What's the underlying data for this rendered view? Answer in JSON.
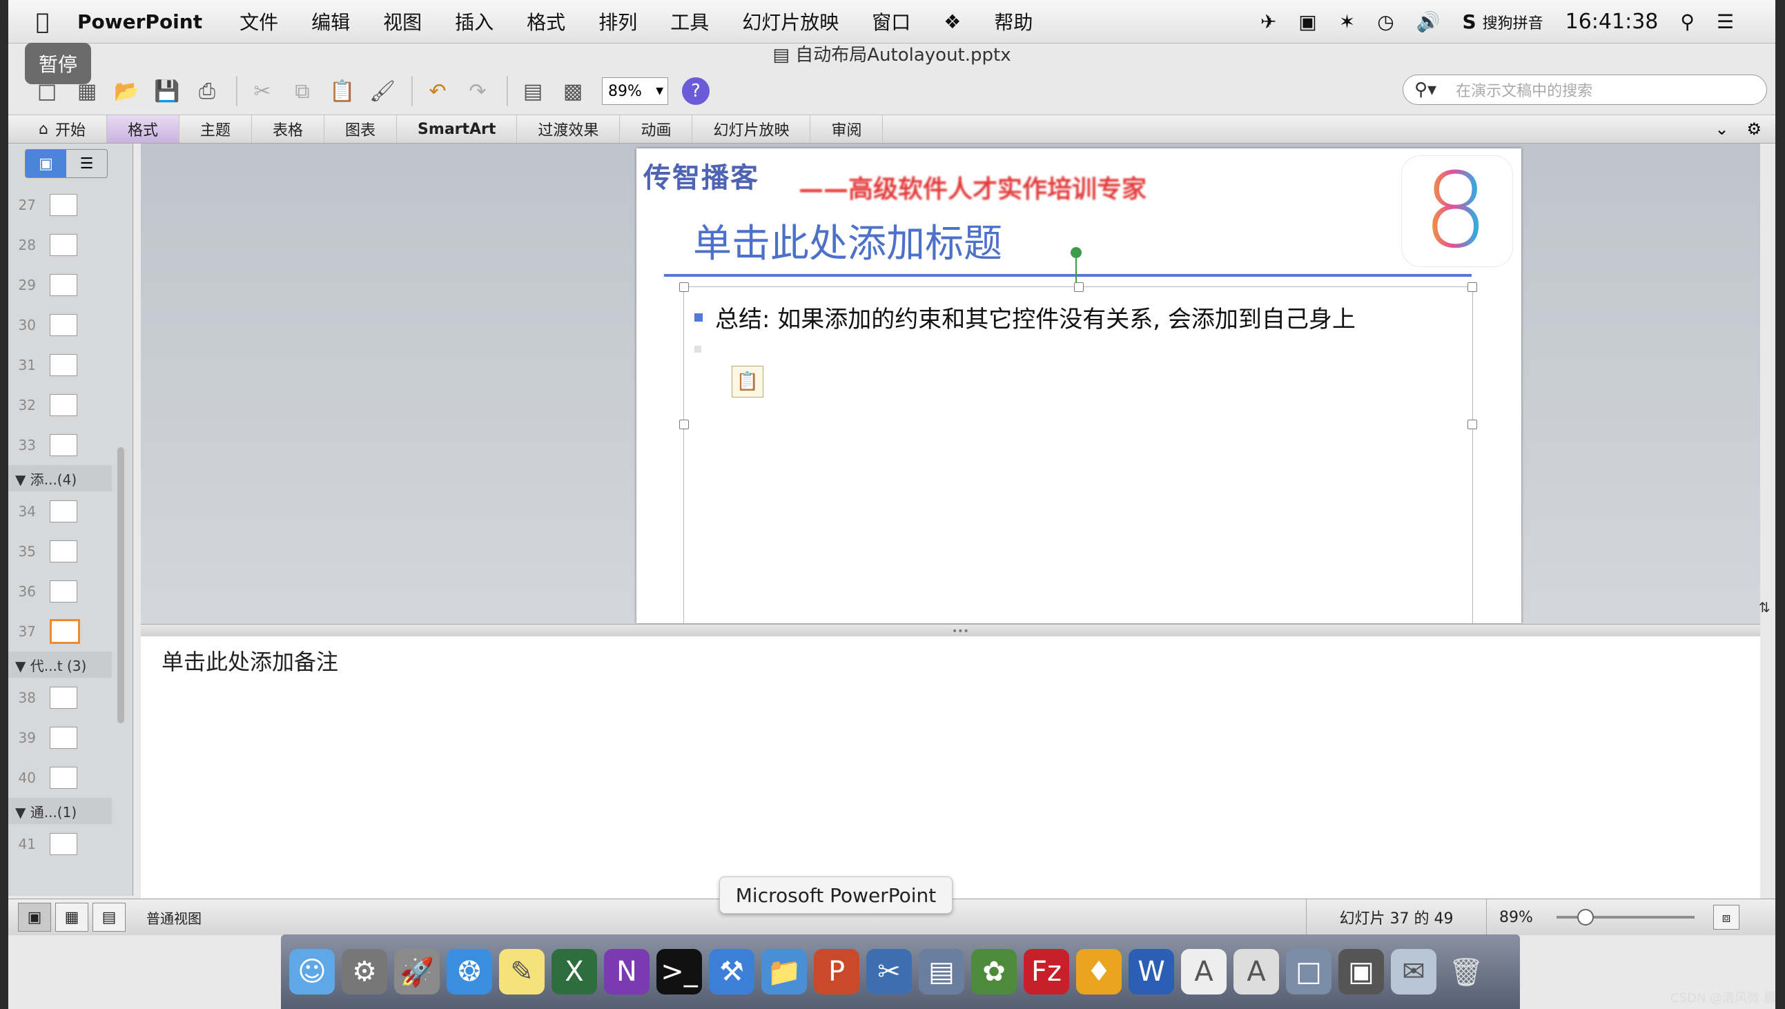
{
  "menubar": {
    "apple": "",
    "app": "PowerPoint",
    "items": [
      "文件",
      "编辑",
      "视图",
      "插入",
      "格式",
      "排列",
      "工具",
      "幻灯片放映",
      "窗口",
      "帮助"
    ],
    "ime": "搜狗拼音",
    "clock": "16:41:38"
  },
  "pause_badge": "暂停",
  "document_title": "自动布局Autolayout.pptx",
  "toolbar": {
    "zoom": "89%",
    "search_placeholder": "在演示文稿中的搜索"
  },
  "ribbon": {
    "tabs": [
      "开始",
      "格式",
      "主题",
      "表格",
      "图表",
      "SmartArt",
      "过渡效果",
      "动画",
      "幻灯片放映",
      "审阅"
    ],
    "active_index": 1
  },
  "slide_panel": {
    "rows": [
      {
        "type": "thumb",
        "num": "27"
      },
      {
        "type": "thumb",
        "num": "28"
      },
      {
        "type": "thumb",
        "num": "29"
      },
      {
        "type": "thumb",
        "num": "30"
      },
      {
        "type": "thumb",
        "num": "31"
      },
      {
        "type": "thumb",
        "num": "32"
      },
      {
        "type": "thumb",
        "num": "33"
      },
      {
        "type": "section",
        "label": "▼ 添...(4)"
      },
      {
        "type": "thumb",
        "num": "34"
      },
      {
        "type": "thumb",
        "num": "35"
      },
      {
        "type": "thumb",
        "num": "36"
      },
      {
        "type": "thumb",
        "num": "37",
        "selected": true
      },
      {
        "type": "section",
        "label": "▼ 代...t (3)"
      },
      {
        "type": "thumb",
        "num": "38"
      },
      {
        "type": "thumb",
        "num": "39"
      },
      {
        "type": "thumb",
        "num": "40"
      },
      {
        "type": "section",
        "label": "▼ 通...(1)"
      },
      {
        "type": "thumb",
        "num": "41"
      }
    ]
  },
  "slide": {
    "logo_text": "传智播客",
    "tagline": "——高级软件人才实作培训专家",
    "corner_badge": "8",
    "title": "单击此处添加标题",
    "bullet": "总结: 如果添加的约束和其它控件没有关系, 会添加到自己身上"
  },
  "notes": {
    "placeholder": "单击此处添加备注"
  },
  "statusbar": {
    "view_name": "普通视图",
    "slide_info": "幻灯片 37 的 49",
    "zoom": "89%",
    "zoom_level_percent": 20
  },
  "tooltip": "Microsoft PowerPoint",
  "watermark": "CSDN @清风微 晨",
  "colors": {
    "accent": "#4f7ad7",
    "title": "#4d71c9",
    "selection": "#f08a2e"
  }
}
